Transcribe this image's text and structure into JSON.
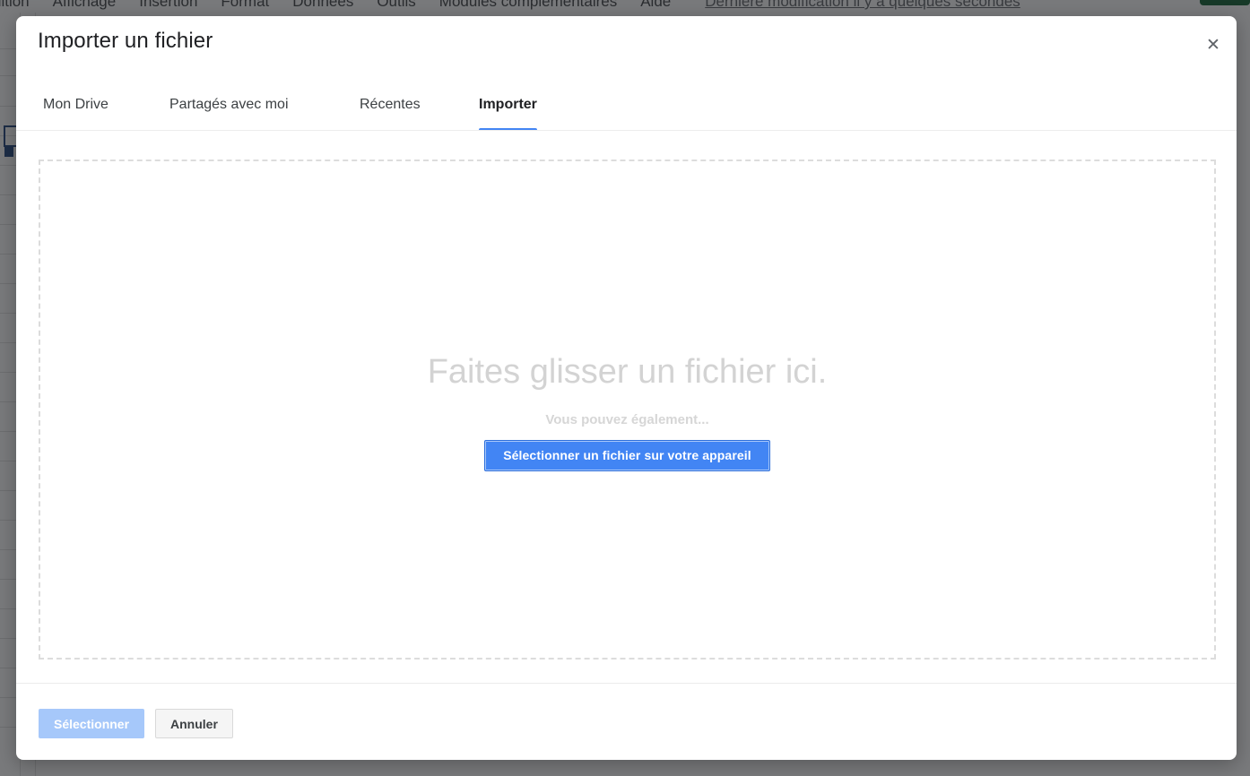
{
  "background": {
    "menu_items": [
      "dition",
      "Affichage",
      "Insertion",
      "Format",
      "Données",
      "Outils",
      "Modules complémentaires",
      "Aide"
    ],
    "last_edit": "Dernière modification il y a quelques secondes",
    "share_color": "#0b5c2e",
    "cell_selection_color": "#1a3f7a"
  },
  "dialog": {
    "title": "Importer un fichier",
    "close_label": "✕",
    "close_icon": "close-icon",
    "tabs": [
      {
        "label": "Mon Drive",
        "active": false
      },
      {
        "label": "Partagés avec moi",
        "active": false
      },
      {
        "label": "Récentes",
        "active": false
      },
      {
        "label": "Importer",
        "active": true
      }
    ],
    "active_tab_color": "#4285f4",
    "dropzone": {
      "title": "Faites glisser un fichier ici.",
      "subtitle": "Vous pouvez également...",
      "pick_button": "Sélectionner un fichier sur votre appareil",
      "pick_button_color": "#4285f4",
      "border_color": "#dcdcdc"
    },
    "footer": {
      "confirm_label": "Sélectionner",
      "confirm_color": "#a6c8fa",
      "cancel_label": "Annuler"
    }
  }
}
